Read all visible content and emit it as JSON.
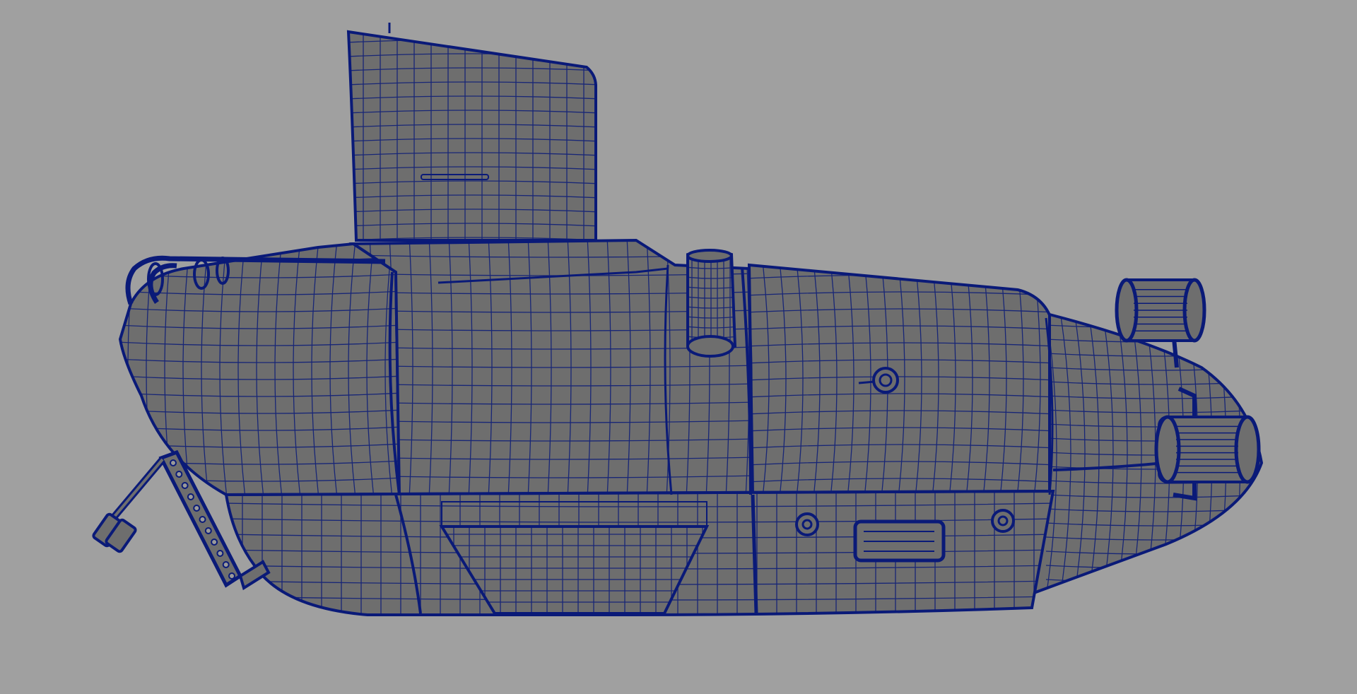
{
  "viewport": {
    "background_color": "#a0a0a0",
    "mesh_fill_color": "#6e6e6e",
    "wireframe_color": "#0a1a78",
    "display_mode": "wireframe-on-shaded",
    "view": "side"
  },
  "scene": {
    "object": "submarine",
    "visible_parts": [
      "conning-tower",
      "hull-rear",
      "hull-middle",
      "hull-front",
      "nose-cone",
      "periscope-pipe",
      "ventral-keel",
      "rear-handrail",
      "rear-mechanical-arm",
      "upper-spotlight",
      "lower-spotlight",
      "side-porthole",
      "lower-hatch"
    ]
  }
}
